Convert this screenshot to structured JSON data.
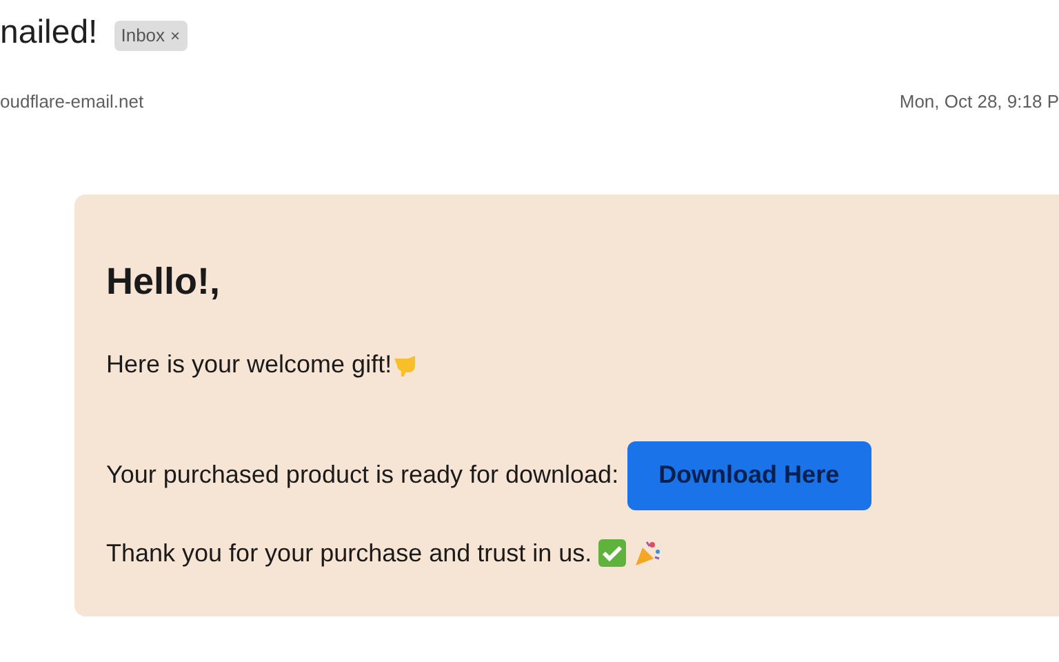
{
  "subject": "nailed!",
  "label": {
    "text": "Inbox",
    "remove": "×"
  },
  "sender": "oudflare-email.net",
  "date": "Mon, Oct 28, 9:18 P",
  "body": {
    "greeting": "Hello!,",
    "gift_line": "Here is your welcome gift!",
    "download_line": "Your purchased product is ready for download:",
    "button": "Download Here",
    "thanks_line": "Thank you for your purchase and trust in us."
  }
}
